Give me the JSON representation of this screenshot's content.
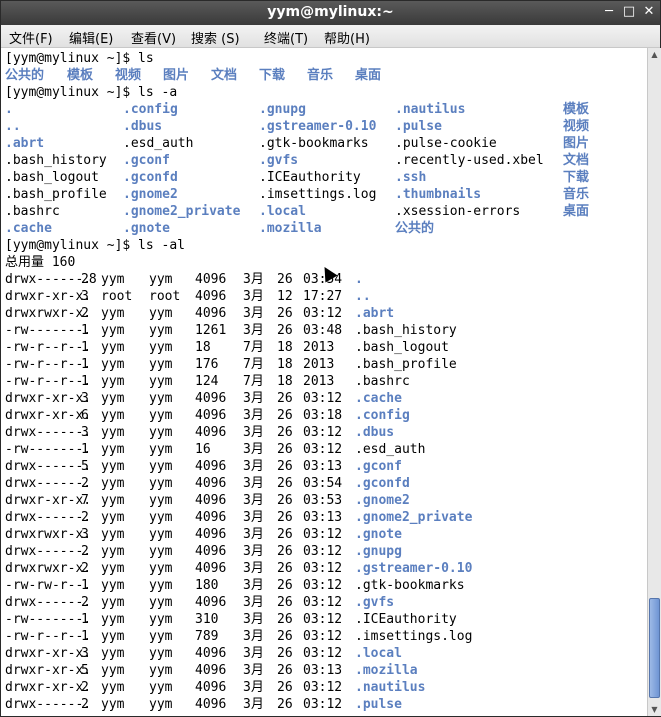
{
  "window": {
    "title": "yym@mylinux:~",
    "min": "─",
    "max": "□",
    "close": "✕"
  },
  "menu": [
    "文件(F)",
    "编辑(E)",
    "查看(V)",
    "搜索 (S)",
    "终端(T)",
    "帮助(H)"
  ],
  "terminal": {
    "prompt1": "[yym@mylinux ~]$ ls",
    "ls_items": [
      "公共的",
      "模板",
      "视频",
      "图片",
      "文档",
      "下载",
      "音乐",
      "桌面"
    ],
    "prompt2": "[yym@mylinux ~]$ ls -a",
    "ls_a_rows": [
      [
        ".",
        ".config",
        ".gnupg",
        ".nautilus",
        "模板"
      ],
      [
        "..",
        ".dbus",
        ".gstreamer-0.10",
        ".pulse",
        "视频"
      ],
      [
        ".abrt",
        ".esd_auth",
        ".gtk-bookmarks",
        ".pulse-cookie",
        "图片"
      ],
      [
        ".bash_history",
        ".gconf",
        ".gvfs",
        ".recently-used.xbel",
        "文档"
      ],
      [
        ".bash_logout",
        ".gconfd",
        ".ICEauthority",
        ".ssh",
        "下载"
      ],
      [
        ".bash_profile",
        ".gnome2",
        ".imsettings.log",
        ".thumbnails",
        "音乐"
      ],
      [
        ".bashrc",
        ".gnome2_private",
        ".local",
        ".xsession-errors",
        "桌面"
      ],
      [
        ".cache",
        ".gnote",
        ".mozilla",
        "公共的",
        ""
      ]
    ],
    "ls_a_blue": [
      [
        true,
        true,
        true,
        true,
        true
      ],
      [
        true,
        true,
        true,
        true,
        true
      ],
      [
        true,
        false,
        false,
        false,
        true
      ],
      [
        false,
        true,
        true,
        false,
        true
      ],
      [
        false,
        true,
        false,
        true,
        true
      ],
      [
        false,
        true,
        false,
        true,
        true
      ],
      [
        false,
        true,
        true,
        false,
        true
      ],
      [
        true,
        true,
        true,
        true,
        false
      ]
    ],
    "prompt3": "[yym@mylinux ~]$ ls -al",
    "total": "总用量 160",
    "ls_al": [
      [
        "drwx------.",
        "28",
        "yym",
        "yym",
        "4096",
        "3月",
        "26",
        "03:54",
        ".",
        true
      ],
      [
        "drwxr-xr-x.",
        "3",
        "root",
        "root",
        "4096",
        "3月",
        "12",
        "17:27",
        "..",
        true
      ],
      [
        "drwxrwxr-x.",
        "2",
        "yym",
        "yym",
        "4096",
        "3月",
        "26",
        "03:12",
        ".abrt",
        true
      ],
      [
        "-rw-------.",
        "1",
        "yym",
        "yym",
        "1261",
        "3月",
        "26",
        "03:48",
        ".bash_history",
        false
      ],
      [
        "-rw-r--r--.",
        "1",
        "yym",
        "yym",
        "18",
        "7月",
        "18",
        "2013",
        ".bash_logout",
        false
      ],
      [
        "-rw-r--r--.",
        "1",
        "yym",
        "yym",
        "176",
        "7月",
        "18",
        "2013",
        ".bash_profile",
        false
      ],
      [
        "-rw-r--r--.",
        "1",
        "yym",
        "yym",
        "124",
        "7月",
        "18",
        "2013",
        ".bashrc",
        false
      ],
      [
        "drwxr-xr-x.",
        "3",
        "yym",
        "yym",
        "4096",
        "3月",
        "26",
        "03:12",
        ".cache",
        true
      ],
      [
        "drwxr-xr-x.",
        "6",
        "yym",
        "yym",
        "4096",
        "3月",
        "26",
        "03:18",
        ".config",
        true
      ],
      [
        "drwx------.",
        "3",
        "yym",
        "yym",
        "4096",
        "3月",
        "26",
        "03:12",
        ".dbus",
        true
      ],
      [
        "-rw-------.",
        "1",
        "yym",
        "yym",
        "16",
        "3月",
        "26",
        "03:12",
        ".esd_auth",
        false
      ],
      [
        "drwx------.",
        "5",
        "yym",
        "yym",
        "4096",
        "3月",
        "26",
        "03:13",
        ".gconf",
        true
      ],
      [
        "drwx------.",
        "2",
        "yym",
        "yym",
        "4096",
        "3月",
        "26",
        "03:54",
        ".gconfd",
        true
      ],
      [
        "drwxr-xr-x.",
        "7",
        "yym",
        "yym",
        "4096",
        "3月",
        "26",
        "03:53",
        ".gnome2",
        true
      ],
      [
        "drwx------.",
        "2",
        "yym",
        "yym",
        "4096",
        "3月",
        "26",
        "03:13",
        ".gnome2_private",
        true
      ],
      [
        "drwxrwxr-x.",
        "3",
        "yym",
        "yym",
        "4096",
        "3月",
        "26",
        "03:12",
        ".gnote",
        true
      ],
      [
        "drwx------.",
        "2",
        "yym",
        "yym",
        "4096",
        "3月",
        "26",
        "03:12",
        ".gnupg",
        true
      ],
      [
        "drwxrwxr-x.",
        "2",
        "yym",
        "yym",
        "4096",
        "3月",
        "26",
        "03:12",
        ".gstreamer-0.10",
        true
      ],
      [
        "-rw-rw-r--.",
        "1",
        "yym",
        "yym",
        "180",
        "3月",
        "26",
        "03:12",
        ".gtk-bookmarks",
        false
      ],
      [
        "drwx------.",
        "2",
        "yym",
        "yym",
        "4096",
        "3月",
        "26",
        "03:12",
        ".gvfs",
        true
      ],
      [
        "-rw-------.",
        "1",
        "yym",
        "yym",
        "310",
        "3月",
        "26",
        "03:12",
        ".ICEauthority",
        false
      ],
      [
        "-rw-r--r--.",
        "1",
        "yym",
        "yym",
        "789",
        "3月",
        "26",
        "03:12",
        ".imsettings.log",
        false
      ],
      [
        "drwxr-xr-x.",
        "3",
        "yym",
        "yym",
        "4096",
        "3月",
        "26",
        "03:12",
        ".local",
        true
      ],
      [
        "drwxr-xr-x.",
        "5",
        "yym",
        "yym",
        "4096",
        "3月",
        "26",
        "03:13",
        ".mozilla",
        true
      ],
      [
        "drwxr-xr-x.",
        "2",
        "yym",
        "yym",
        "4096",
        "3月",
        "26",
        "03:12",
        ".nautilus",
        true
      ],
      [
        "drwx------.",
        "2",
        "yym",
        "yym",
        "4096",
        "3月",
        "26",
        "03:12",
        ".pulse",
        true
      ]
    ]
  },
  "scrollbar": {
    "up": "▲",
    "down": "▼"
  },
  "colors": {
    "dir_blue": "#5b7fbf",
    "titlebar": "#3a3a3a"
  }
}
